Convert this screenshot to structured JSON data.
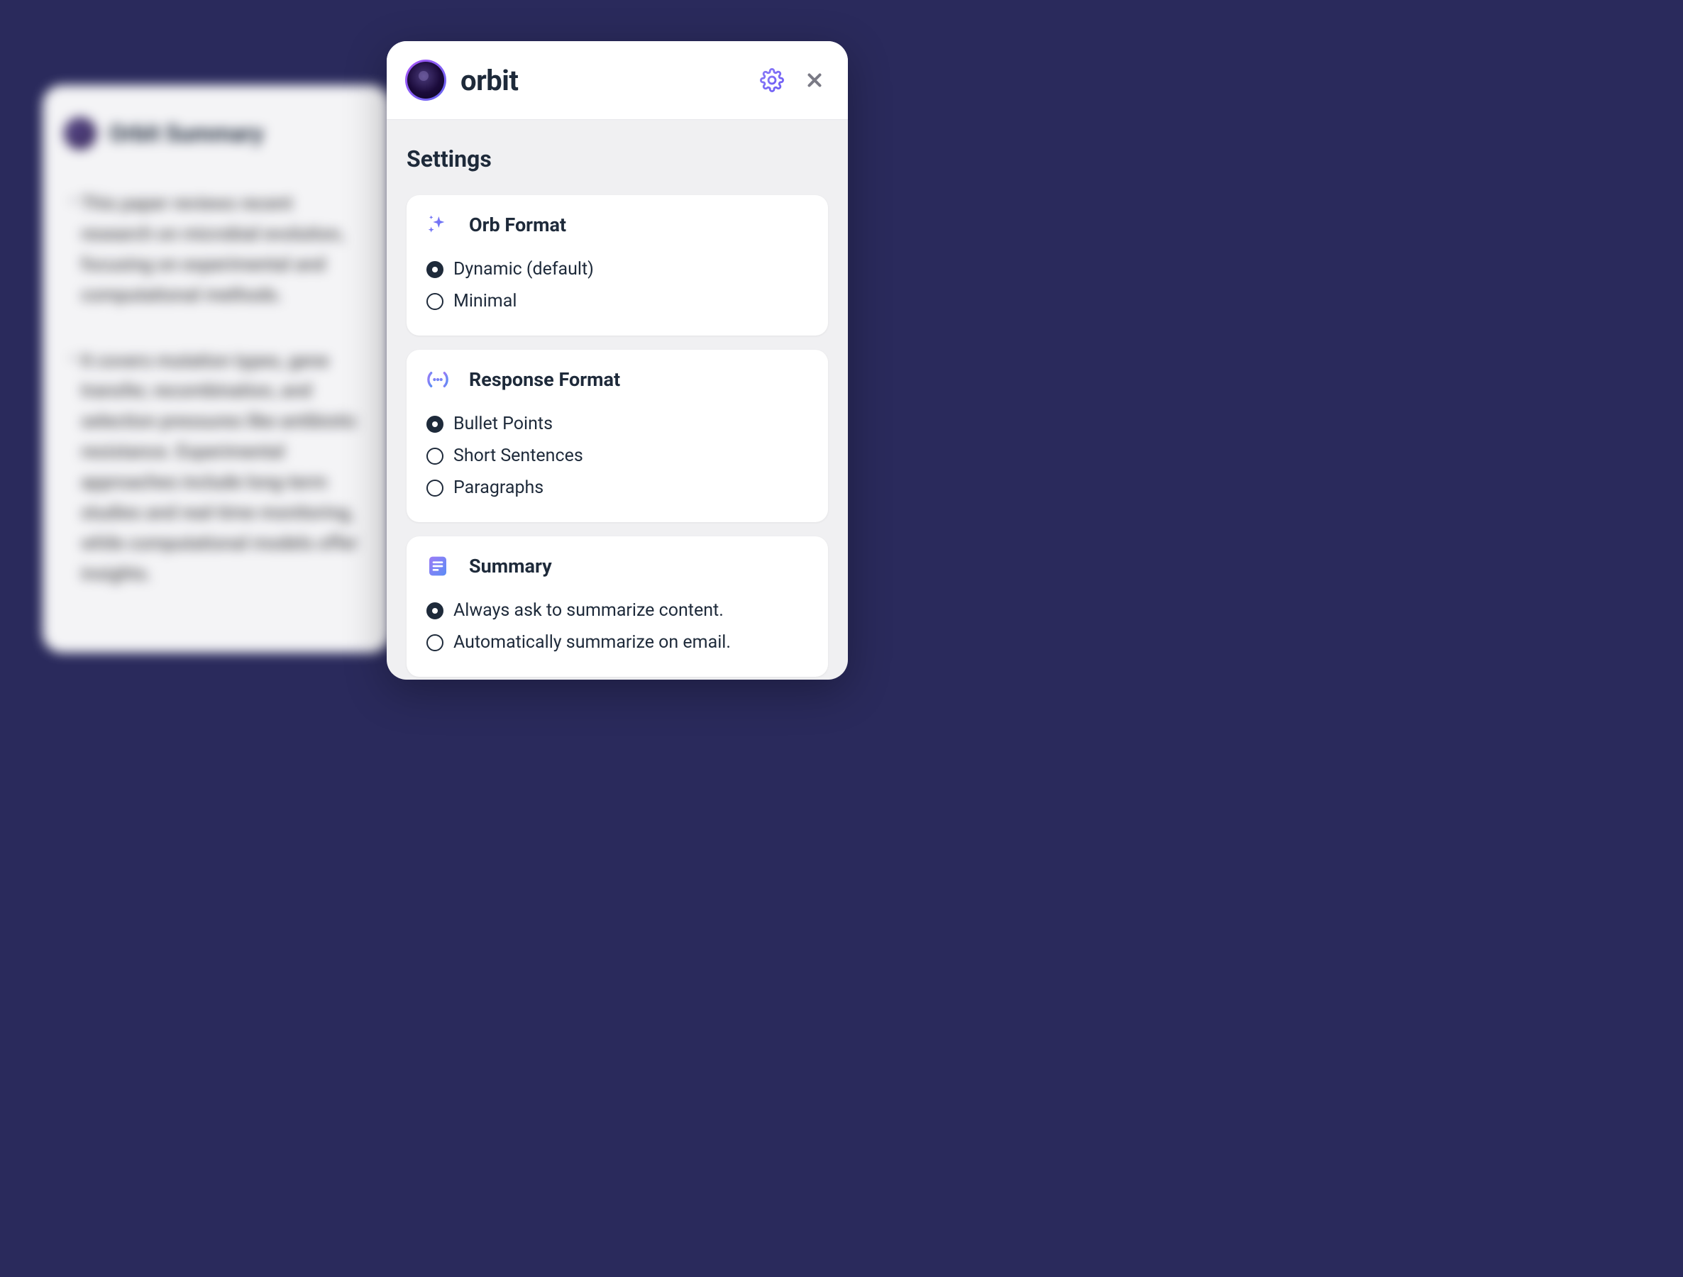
{
  "app_name": "orbit",
  "settings_title": "Settings",
  "background_card": {
    "title": "Orbit Summary",
    "bullets": [
      "This paper reviews recent research on microbial evolution, focusing on experimental and computational methods.",
      "It covers mutation types, gene transfer, recombination, and selection pressures like antibiotic resistance. Experimental approaches include long-term studies and real-time monitoring, while computational models offer insights."
    ]
  },
  "sections": [
    {
      "id": "orb-format",
      "title": "Orb Format",
      "icon": "sparkle",
      "options": [
        {
          "label": "Dynamic (default)",
          "selected": true
        },
        {
          "label": "Minimal",
          "selected": false
        }
      ]
    },
    {
      "id": "response-format",
      "title": "Response Format",
      "icon": "response",
      "options": [
        {
          "label": "Bullet Points",
          "selected": true
        },
        {
          "label": "Short Sentences",
          "selected": false
        },
        {
          "label": "Paragraphs",
          "selected": false
        }
      ]
    },
    {
      "id": "summary",
      "title": "Summary",
      "icon": "summary",
      "options": [
        {
          "label": "Always ask to summarize content.",
          "selected": true
        },
        {
          "label": "Automatically summarize on email.",
          "selected": false
        }
      ]
    }
  ]
}
